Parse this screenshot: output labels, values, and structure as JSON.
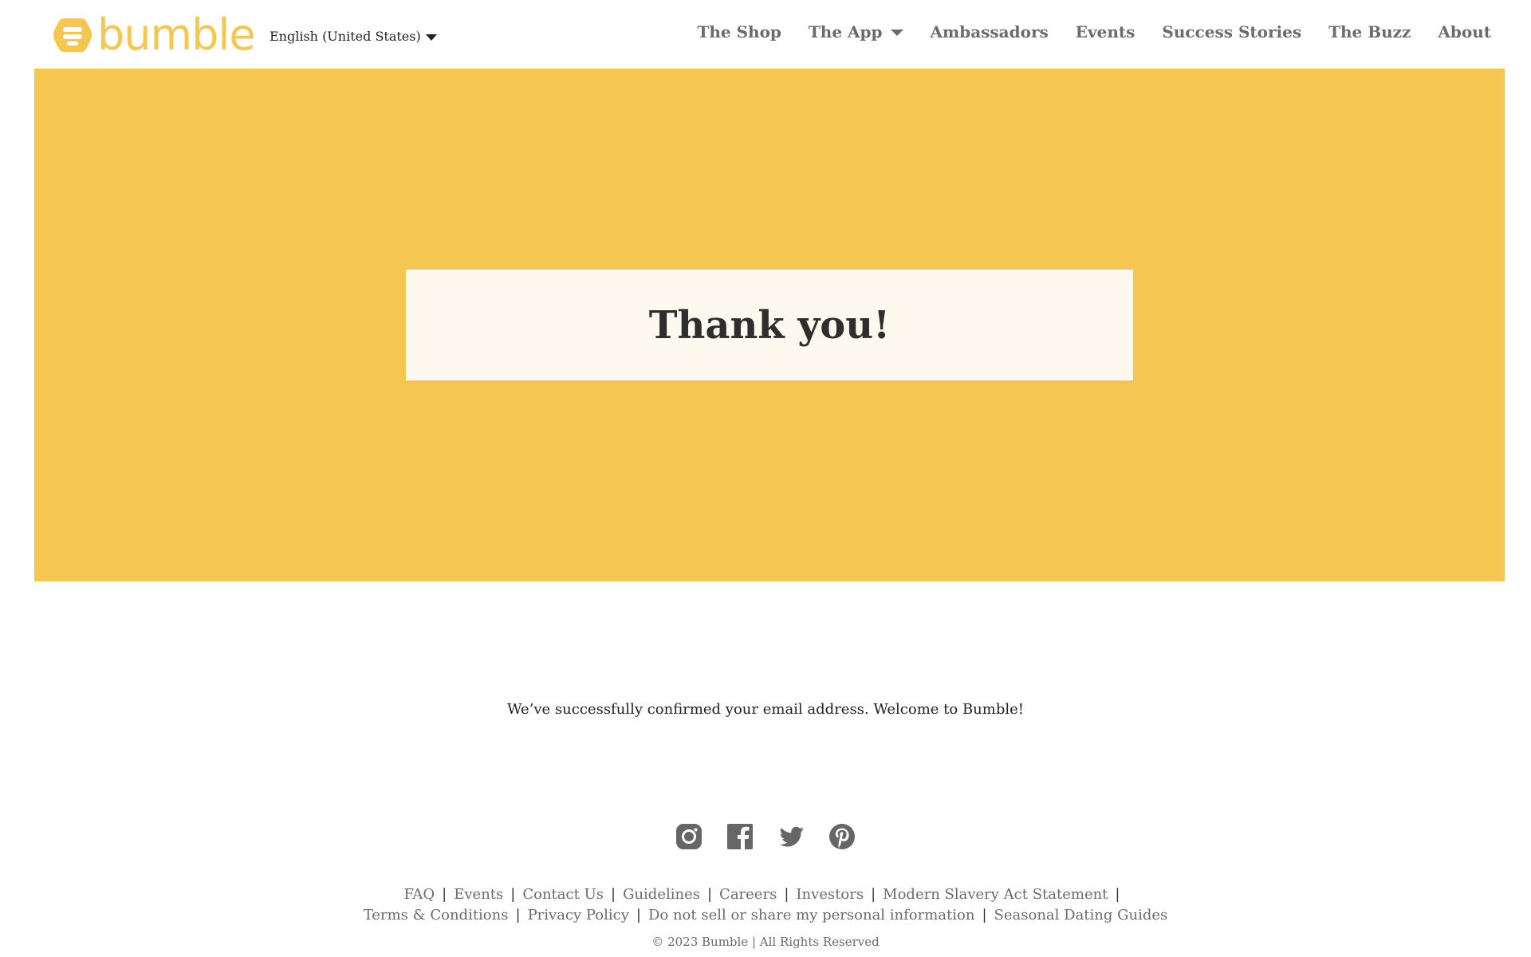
{
  "header": {
    "brand": "bumble",
    "language": "English (United States)",
    "nav": [
      {
        "label": "The Shop"
      },
      {
        "label": "The App"
      },
      {
        "label": "Ambassadors"
      },
      {
        "label": "Events"
      },
      {
        "label": "Success Stories"
      },
      {
        "label": "The Buzz"
      },
      {
        "label": "About"
      }
    ]
  },
  "hero": {
    "title": "Thank you!"
  },
  "message": "We’ve successfully confirmed your email address. Welcome to Bumble!",
  "footer": {
    "social": [
      "instagram-icon",
      "facebook-icon",
      "twitter-icon",
      "pinterest-icon"
    ],
    "links_row1": [
      "FAQ",
      "Events",
      "Contact Us",
      "Guidelines",
      "Careers",
      "Investors",
      "Modern Slavery Act Statement"
    ],
    "links_row2": [
      "Terms & Conditions",
      "Privacy Policy",
      "Do not sell or share my personal information",
      "Seasonal Dating Guides"
    ],
    "separator": "|",
    "copyright": "© 2023 Bumble | All Rights Reserved"
  },
  "colors": {
    "brand_yellow": "#f5c751",
    "card_cream": "#fdf9ee",
    "nav_gray": "#6b6b6b"
  }
}
